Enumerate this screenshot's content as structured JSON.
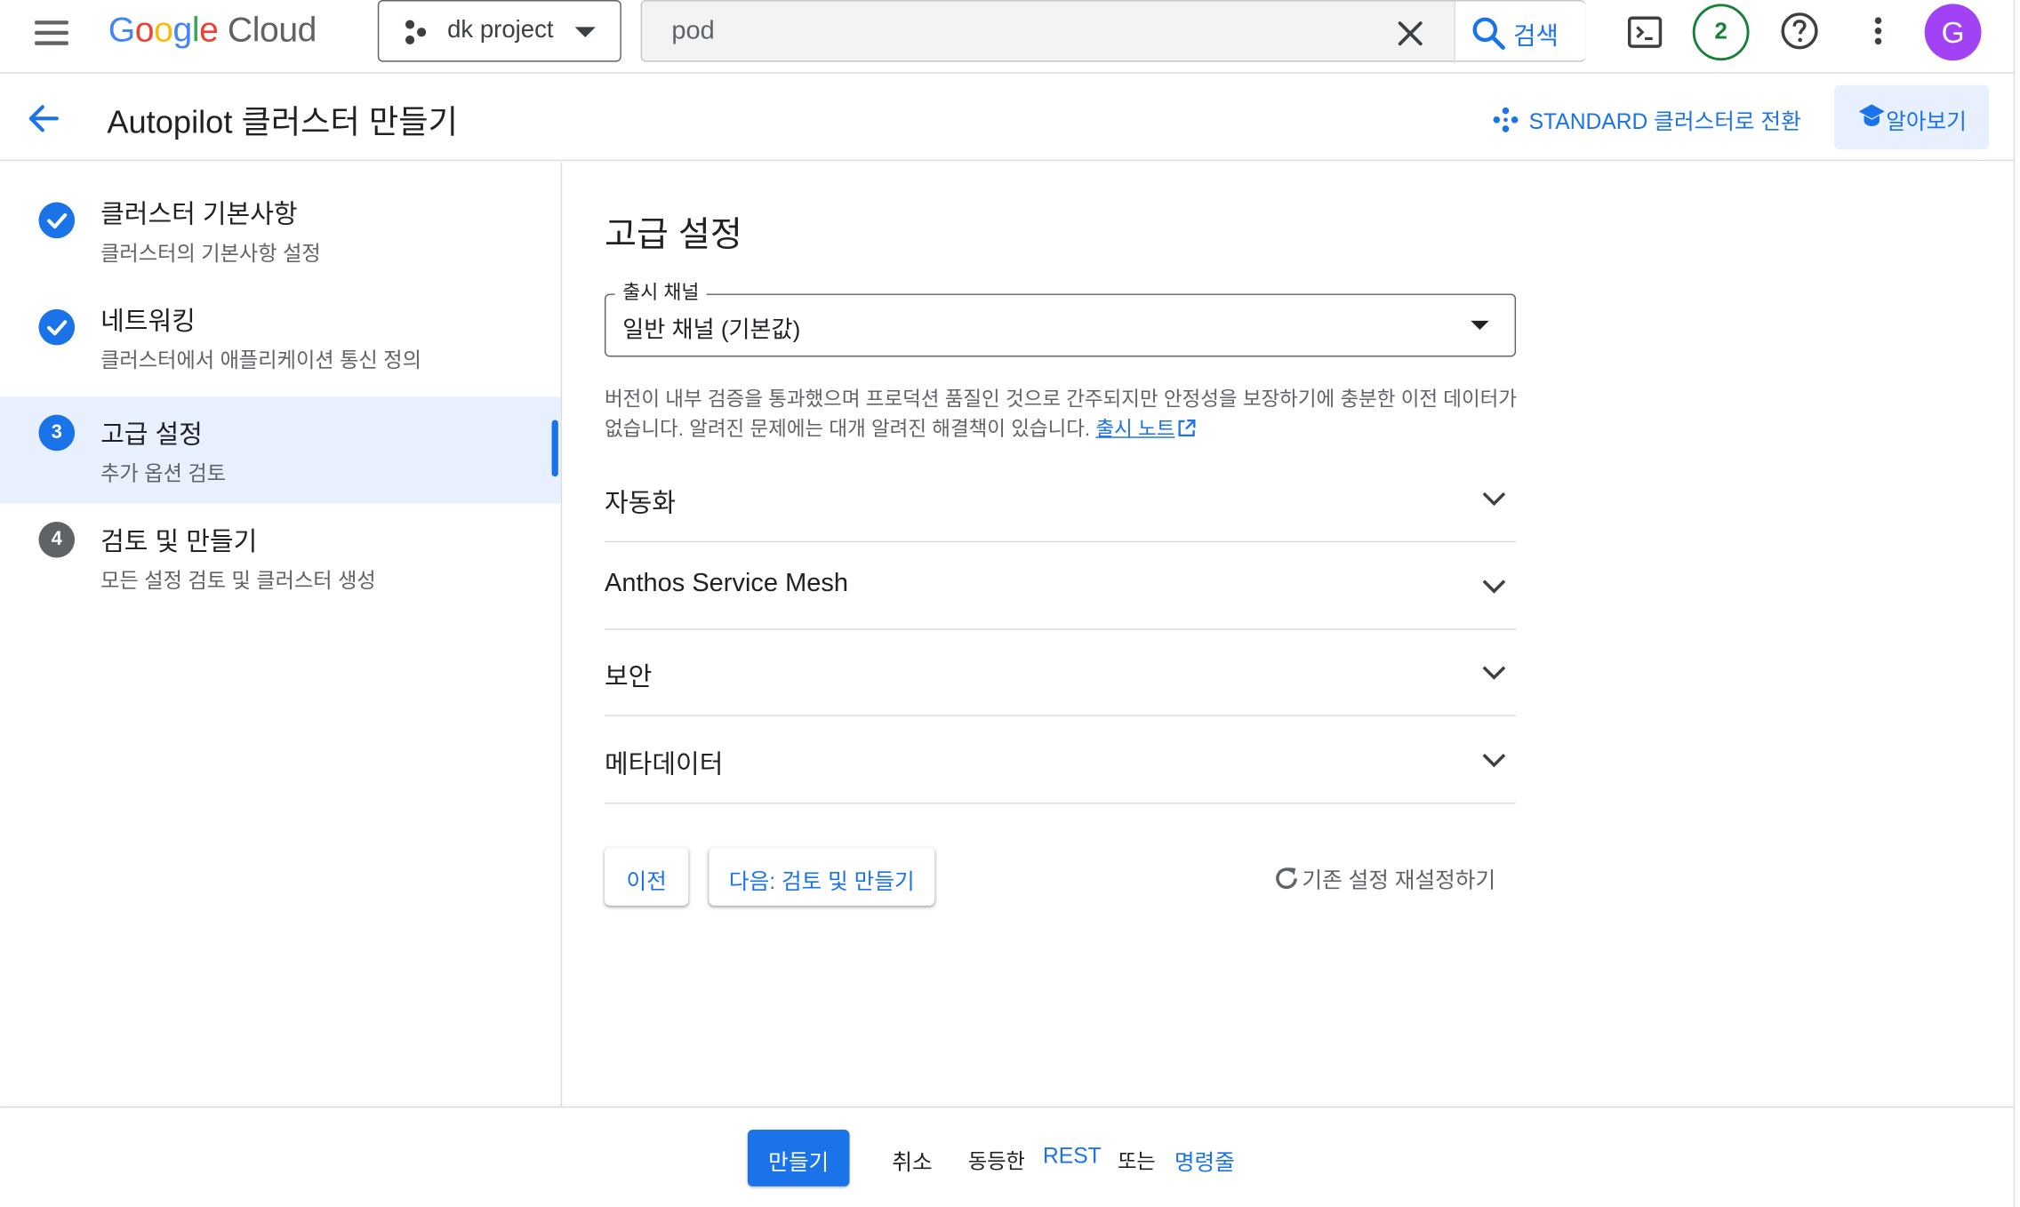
{
  "topbar": {
    "logo_google": [
      "G",
      "o",
      "o",
      "g",
      "l",
      "e"
    ],
    "logo_cloud": "Cloud",
    "project_name": "dk project",
    "search_value": "pod",
    "search_button": "검색",
    "notification_count": "2",
    "avatar_letter": "G"
  },
  "header": {
    "title": "Autopilot 클러스터 만들기",
    "standard_switch": "STANDARD 클러스터로 전환",
    "learn": "알아보기"
  },
  "stepper": [
    {
      "title": "클러스터 기본사항",
      "sub": "클러스터의 기본사항 설정",
      "state": "done",
      "marker": ""
    },
    {
      "title": "네트워킹",
      "sub": "클러스터에서 애플리케이션 통신 정의",
      "state": "done",
      "marker": ""
    },
    {
      "title": "고급 설정",
      "sub": "추가 옵션 검토",
      "state": "current",
      "marker": "3"
    },
    {
      "title": "검토 및 만들기",
      "sub": "모든 설정 검토 및 클러스터 생성",
      "state": "todo",
      "marker": "4"
    }
  ],
  "main": {
    "section_title": "고급 설정",
    "release_channel_label": "출시 채널",
    "release_channel_value": "일반 채널 (기본값)",
    "help_text": "버전이 내부 검증을 통과했으며 프로덕션 품질인 것으로 간주되지만 안정성을 보장하기에 충분한 이전 데이터가 없습니다. 알려진 문제에는 대개 알려진 해결책이 있습니다.",
    "release_notes_link": "출시 노트",
    "accordions": [
      "자동화",
      "Anthos Service Mesh",
      "보안",
      "메타데이터"
    ],
    "prev_button": "이전",
    "next_button": "다음: 검토 및 만들기",
    "reset_button": "기존 설정 재설정하기"
  },
  "footer": {
    "create": "만들기",
    "cancel": "취소",
    "equivalent": "동등한",
    "rest": "REST",
    "or": "또는",
    "cli": "명령줄"
  },
  "colors": {
    "accent": "#1a73e8",
    "active_bg": "#e8f0fe",
    "badge_green": "#188038",
    "avatar": "#a142f4"
  }
}
